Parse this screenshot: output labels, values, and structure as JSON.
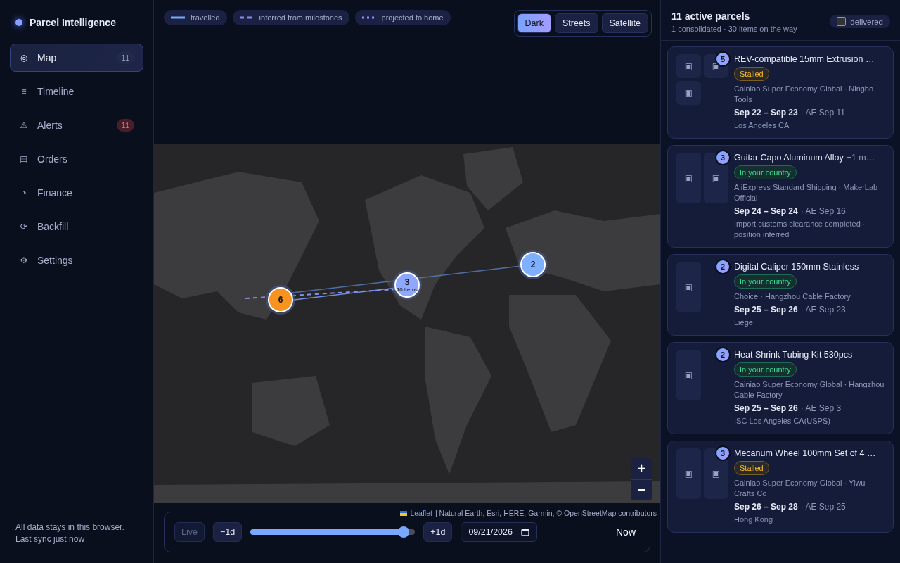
{
  "app": {
    "name": "Parcel Intelligence"
  },
  "nav": [
    {
      "icon": "◎",
      "label": "Map",
      "selected": true,
      "badge": {
        "text": "11",
        "kind": "neutral"
      }
    },
    {
      "icon": "≡",
      "label": "Timeline",
      "selected": false
    },
    {
      "icon": "⚠",
      "label": "Alerts",
      "selected": false,
      "badge": {
        "text": "11",
        "kind": "alert"
      }
    },
    {
      "icon": "▤",
      "label": "Orders",
      "selected": false
    },
    {
      "icon": "◔",
      "label": "Finance",
      "selected": false
    },
    {
      "icon": "⟳",
      "label": "Backfill",
      "selected": false
    },
    {
      "icon": "⚙",
      "label": "Settings",
      "selected": false
    }
  ],
  "sidebar_footer": [
    "All data stays in this browser.",
    "Last sync just now"
  ],
  "legend": [
    {
      "kind": "travelled",
      "label": "travelled"
    },
    {
      "kind": "inferred",
      "label": "inferred from milestones"
    },
    {
      "kind": "projected",
      "label": "projected to home"
    }
  ],
  "map_styles": [
    {
      "label": "Dark",
      "selected": true
    },
    {
      "label": "Streets",
      "selected": false
    },
    {
      "label": "Satellite",
      "selected": false
    }
  ],
  "markers": [
    {
      "label": "6",
      "color": "#f7931e"
    },
    {
      "label": "3",
      "sub": "10 items",
      "color": "#8fa8ff"
    },
    {
      "label": "2",
      "color": "#7fb0ff"
    }
  ],
  "zoom": {
    "in": "+",
    "out": "−"
  },
  "attribution": {
    "link": "Leaflet",
    "text": "| Natural Earth, Esri, HERE, Garmin, © OpenStreetMap contributors"
  },
  "timeline": {
    "live": {
      "label": "Live",
      "disabled": true
    },
    "back": "−1d",
    "forward": "+1d",
    "level": 0.93,
    "date": "09/21/2026",
    "now": "Now"
  },
  "panel": {
    "title": "11 active parcels",
    "subtitle": "1 consolidated · 30 items on the way",
    "delivered": {
      "label": "delivered",
      "checked": false
    }
  },
  "parcels": [
    {
      "count": "5",
      "thumbnails": [
        "▣",
        "▣",
        "▣"
      ],
      "title": "REV-compatible 15mm Extrusion …",
      "status": {
        "label": "Stalled",
        "kind": "stalled"
      },
      "carrier": "Cainiao Super Economy Global · Ningbo Tools",
      "dates": "Sep 22 – Sep 23",
      "ae": "· AE Sep 11",
      "location": "Los Angeles CA"
    },
    {
      "count": "3",
      "thumbnails": [
        "▣",
        "▣"
      ],
      "title": "Guitar Capo Aluminum Alloy",
      "title_extra": "+1 m…",
      "status": {
        "label": "In your country",
        "kind": "country"
      },
      "carrier": "AliExpress Standard Shipping · MakerLab Official",
      "dates": "Sep 24 – Sep 24",
      "ae": "· AE Sep 16",
      "location": "Import customs clearance completed · position inferred"
    },
    {
      "count": "2",
      "thumbnails": [
        "▣"
      ],
      "title": "Digital Caliper 150mm Stainless",
      "status": {
        "label": "In your country",
        "kind": "country"
      },
      "carrier": "Choice · Hangzhou Cable Factory",
      "dates": "Sep 25 – Sep 26",
      "ae": "· AE Sep 23",
      "location": "Liège"
    },
    {
      "count": "2",
      "thumbnails": [
        "▣"
      ],
      "title": "Heat Shrink Tubing Kit 530pcs",
      "status": {
        "label": "In your country",
        "kind": "country"
      },
      "carrier": "Cainiao Super Economy Global · Hangzhou Cable Factory",
      "dates": "Sep 25 – Sep 26",
      "ae": "· AE Sep 3",
      "location": "ISC Los Angeles CA(USPS)"
    },
    {
      "count": "3",
      "thumbnails": [
        "▣",
        "▣"
      ],
      "title": "Mecanum Wheel 100mm Set of 4 …",
      "status": {
        "label": "Stalled",
        "kind": "stalled"
      },
      "carrier": "Cainiao Super Economy Global · Yiwu Crafts Co",
      "dates": "Sep 26 – Sep 28",
      "ae": "· AE Sep 25",
      "location": "Hong Kong"
    }
  ]
}
